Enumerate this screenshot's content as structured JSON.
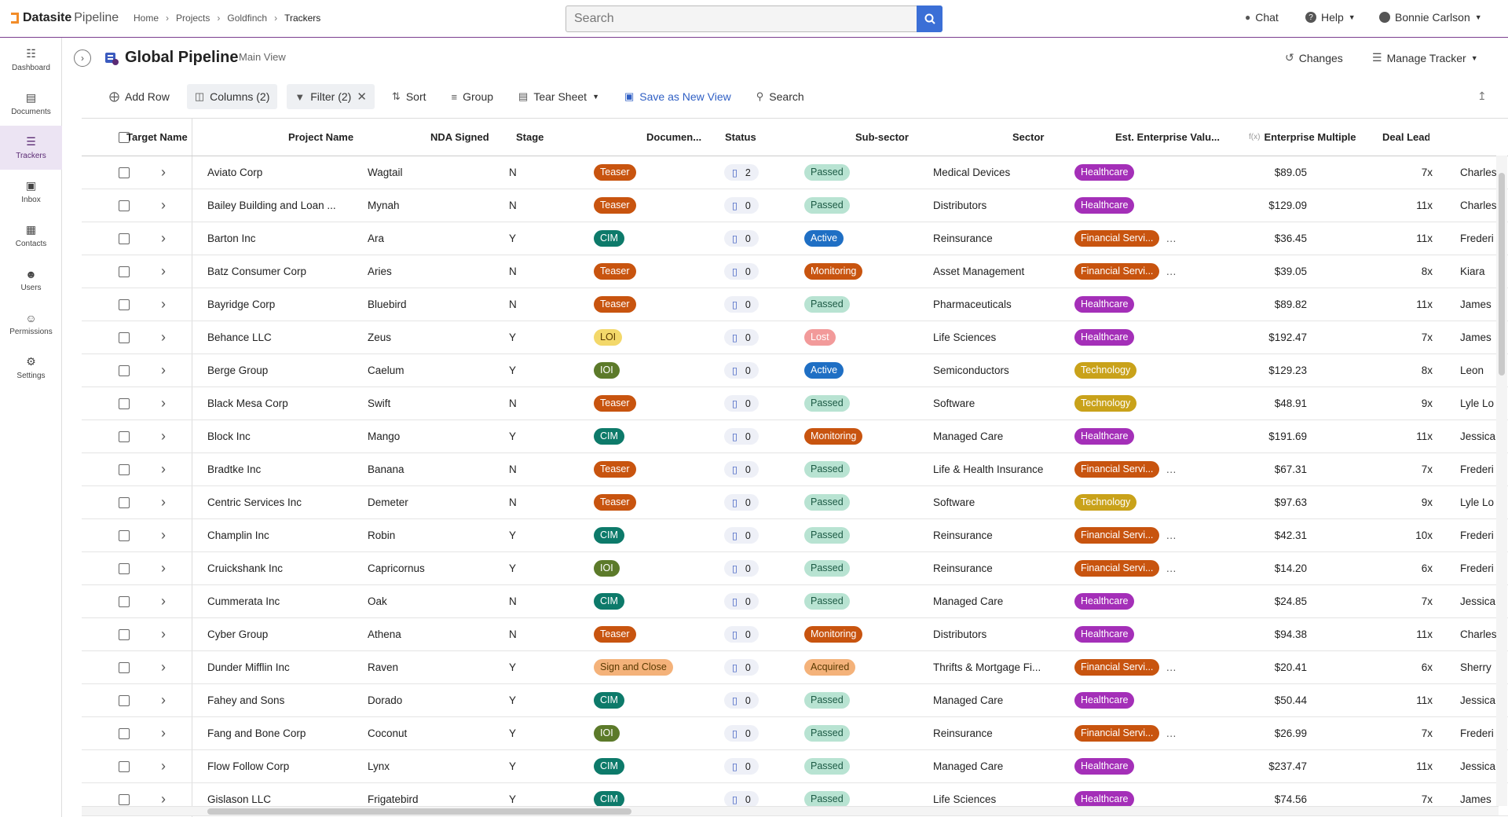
{
  "app": {
    "brand_bold": "Datasite",
    "brand_light": "Pipeline"
  },
  "breadcrumb": [
    "Home",
    "Projects",
    "Goldfinch",
    "Trackers"
  ],
  "search": {
    "placeholder": "Search"
  },
  "top_right": {
    "chat": "Chat",
    "help": "Help",
    "user": "Bonnie Carlson"
  },
  "sidebar": {
    "items": [
      {
        "label": "Dashboard",
        "icon": "chart-icon"
      },
      {
        "label": "Documents",
        "icon": "document-icon"
      },
      {
        "label": "Trackers",
        "icon": "list-icon",
        "active": true
      },
      {
        "label": "Inbox",
        "icon": "inbox-icon"
      },
      {
        "label": "Contacts",
        "icon": "contacts-icon"
      },
      {
        "label": "Users",
        "icon": "users-icon"
      },
      {
        "label": "Permissions",
        "icon": "permissions-icon"
      },
      {
        "label": "Settings",
        "icon": "gear-icon"
      }
    ]
  },
  "header": {
    "title": "Global Pipeline",
    "subtitle": "Main View",
    "changes": "Changes",
    "manage": "Manage Tracker"
  },
  "toolbar": {
    "add_row": "Add Row",
    "columns": "Columns (2)",
    "filter": "Filter (2)",
    "sort": "Sort",
    "group": "Group",
    "tear_sheet": "Tear Sheet",
    "save_view": "Save as New View",
    "search": "Search"
  },
  "columns": [
    "Target Name",
    "Project Name",
    "NDA Signed",
    "Stage",
    "Documen...",
    "Status",
    "Sub-sector",
    "Sector",
    "Est. Enterprise Valu...",
    "Enterprise Multiple",
    "Deal Lead"
  ],
  "colors": {
    "stage": {
      "Teaser": "#c8540f",
      "CIM": "#0d7a6a",
      "LOI": "#f3d86a",
      "IOI": "#5c7a2a",
      "Sign and Close": "#f4b27a"
    },
    "status": {
      "Passed": "#b8e3d2",
      "Active": "#1f6fc4",
      "Monitoring": "#c8540f",
      "Lost": "#f29a9a",
      "Acquired": "#f4b27a"
    },
    "sector": {
      "Healthcare": "#a42fb8",
      "Financial Servi...": "#c8540f",
      "Technology": "#c9a21a"
    }
  },
  "rows": [
    {
      "target": "Aviato Corp",
      "project": "Wagtail",
      "nda": "N",
      "stage": "Teaser",
      "docs": "2",
      "status": "Passed",
      "subsector": "Medical Devices",
      "sector": "Healthcare",
      "ev": "$89.05",
      "mult": "7x",
      "lead": "Charles"
    },
    {
      "target": "Bailey Building and Loan ...",
      "project": "Mynah",
      "nda": "N",
      "stage": "Teaser",
      "docs": "0",
      "status": "Passed",
      "subsector": "Distributors",
      "sector": "Healthcare",
      "ev": "$129.09",
      "mult": "11x",
      "lead": "Charles"
    },
    {
      "target": "Barton Inc",
      "project": "Ara",
      "nda": "Y",
      "stage": "CIM",
      "docs": "0",
      "status": "Active",
      "subsector": "Reinsurance",
      "sector": "Financial Servi...",
      "ev": "$36.45",
      "mult": "11x",
      "lead": "Frederi"
    },
    {
      "target": "Batz Consumer Corp",
      "project": "Aries",
      "nda": "N",
      "stage": "Teaser",
      "docs": "0",
      "status": "Monitoring",
      "subsector": "Asset Management",
      "sector": "Financial Servi...",
      "ev": "$39.05",
      "mult": "8x",
      "lead": "Kiara"
    },
    {
      "target": "Bayridge Corp",
      "project": "Bluebird",
      "nda": "N",
      "stage": "Teaser",
      "docs": "0",
      "status": "Passed",
      "subsector": "Pharmaceuticals",
      "sector": "Healthcare",
      "ev": "$89.82",
      "mult": "11x",
      "lead": "James"
    },
    {
      "target": "Behance LLC",
      "project": "Zeus",
      "nda": "Y",
      "stage": "LOI",
      "docs": "0",
      "status": "Lost",
      "subsector": "Life Sciences",
      "sector": "Healthcare",
      "ev": "$192.47",
      "mult": "7x",
      "lead": "James"
    },
    {
      "target": "Berge Group",
      "project": "Caelum",
      "nda": "Y",
      "stage": "IOI",
      "docs": "0",
      "status": "Active",
      "subsector": "Semiconductors",
      "sector": "Technology",
      "ev": "$129.23",
      "mult": "8x",
      "lead": "Leon"
    },
    {
      "target": "Black Mesa Corp",
      "project": "Swift",
      "nda": "N",
      "stage": "Teaser",
      "docs": "0",
      "status": "Passed",
      "subsector": "Software",
      "sector": "Technology",
      "ev": "$48.91",
      "mult": "9x",
      "lead": "Lyle Lo"
    },
    {
      "target": "Block Inc",
      "project": "Mango",
      "nda": "Y",
      "stage": "CIM",
      "docs": "0",
      "status": "Monitoring",
      "subsector": "Managed Care",
      "sector": "Healthcare",
      "ev": "$191.69",
      "mult": "11x",
      "lead": "Jessica"
    },
    {
      "target": "Bradtke Inc",
      "project": "Banana",
      "nda": "N",
      "stage": "Teaser",
      "docs": "0",
      "status": "Passed",
      "subsector": "Life & Health Insurance",
      "sector": "Financial Servi...",
      "ev": "$67.31",
      "mult": "7x",
      "lead": "Frederi"
    },
    {
      "target": "Centric Services Inc",
      "project": "Demeter",
      "nda": "N",
      "stage": "Teaser",
      "docs": "0",
      "status": "Passed",
      "subsector": "Software",
      "sector": "Technology",
      "ev": "$97.63",
      "mult": "9x",
      "lead": "Lyle Lo"
    },
    {
      "target": "Champlin Inc",
      "project": "Robin",
      "nda": "Y",
      "stage": "CIM",
      "docs": "0",
      "status": "Passed",
      "subsector": "Reinsurance",
      "sector": "Financial Servi...",
      "ev": "$42.31",
      "mult": "10x",
      "lead": "Frederi"
    },
    {
      "target": "Cruickshank Inc",
      "project": "Capricornus",
      "nda": "Y",
      "stage": "IOI",
      "docs": "0",
      "status": "Passed",
      "subsector": "Reinsurance",
      "sector": "Financial Servi...",
      "ev": "$14.20",
      "mult": "6x",
      "lead": "Frederi"
    },
    {
      "target": "Cummerata Inc",
      "project": "Oak",
      "nda": "N",
      "stage": "CIM",
      "docs": "0",
      "status": "Passed",
      "subsector": "Managed Care",
      "sector": "Healthcare",
      "ev": "$24.85",
      "mult": "7x",
      "lead": "Jessica"
    },
    {
      "target": "Cyber Group",
      "project": "Athena",
      "nda": "N",
      "stage": "Teaser",
      "docs": "0",
      "status": "Monitoring",
      "subsector": "Distributors",
      "sector": "Healthcare",
      "ev": "$94.38",
      "mult": "11x",
      "lead": "Charles"
    },
    {
      "target": "Dunder Mifflin Inc",
      "project": "Raven",
      "nda": "Y",
      "stage": "Sign and Close",
      "docs": "0",
      "status": "Acquired",
      "subsector": "Thrifts & Mortgage Fi...",
      "sector": "Financial Servi...",
      "ev": "$20.41",
      "mult": "6x",
      "lead": "Sherry"
    },
    {
      "target": "Fahey and Sons",
      "project": "Dorado",
      "nda": "Y",
      "stage": "CIM",
      "docs": "0",
      "status": "Passed",
      "subsector": "Managed Care",
      "sector": "Healthcare",
      "ev": "$50.44",
      "mult": "11x",
      "lead": "Jessica"
    },
    {
      "target": "Fang and Bone Corp",
      "project": "Coconut",
      "nda": "Y",
      "stage": "IOI",
      "docs": "0",
      "status": "Passed",
      "subsector": "Reinsurance",
      "sector": "Financial Servi...",
      "ev": "$26.99",
      "mult": "7x",
      "lead": "Frederi"
    },
    {
      "target": "Flow Follow Corp",
      "project": "Lynx",
      "nda": "Y",
      "stage": "CIM",
      "docs": "0",
      "status": "Passed",
      "subsector": "Managed Care",
      "sector": "Healthcare",
      "ev": "$237.47",
      "mult": "11x",
      "lead": "Jessica"
    },
    {
      "target": "Gislason LLC",
      "project": "Frigatebird",
      "nda": "Y",
      "stage": "CIM",
      "docs": "0",
      "status": "Passed",
      "subsector": "Life Sciences",
      "sector": "Healthcare",
      "ev": "$74.56",
      "mult": "7x",
      "lead": "James"
    }
  ]
}
